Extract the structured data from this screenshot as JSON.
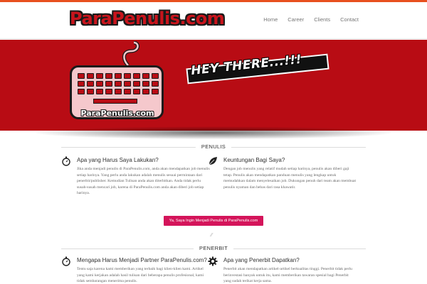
{
  "brand": {
    "logo_text": "ParaPenulis.com",
    "accent_color": "#e8501f",
    "banner_color": "#b80c14",
    "cta_color": "#d4145a"
  },
  "nav": {
    "items": [
      "Home",
      "Career",
      "Clients",
      "Contact"
    ]
  },
  "banner": {
    "keyboard_label": "ParaPenulis.com",
    "greeting": "HEY THERE...!!!"
  },
  "penulis": {
    "section_title": "PENULIS",
    "left": {
      "icon": "stopwatch-icon",
      "title": "Apa yang Harus Saya Lakukan?",
      "body": "Jika anda menjadi penulis di ParaPenulis.com, anda akan mendapatkan job menulis setiap harinya. Yang perlu anda lakukan adalah menulis sesuai permintaan dari penerbit/publisher. Kemudian Tulisan anda akan diterbitkan. Anda tidak perlu susah-susah mencari job, karena di ParaPenulis.com anda akan diberi job setiap harinya."
    },
    "right": {
      "icon": "leaf-icon",
      "title": "Keuntungan Bagi Saya?",
      "body": "Dengan job menulis yang relatif mudah setiap harinya, penulis akan diberi gaji tetap. Penulis akan mendapatkan panduan menulis yang lengkap untuk memudahkan dalam menyelesaikan job. Dukungan penuh dari team akan membuat penulis nyaman dan bebas dari rasa khawatir."
    },
    "cta_label": "Ya, Saya Ingin Menjadi Penulis di ParaPenulis.com"
  },
  "penerbit": {
    "section_title": "PENERBIT",
    "left": {
      "icon": "stopwatch-icon",
      "title": "Mengapa Harus Menjadi Partner ParaPenulis.com?",
      "body": "Tentu saja karena kami memberikan yang terbaik bagi klien-klien kami. Artikel yang kami kerjakan adalah hasil tulisan dari beberapa penulis profesional, kami tidak sembarangan menerima penulis."
    },
    "right": {
      "icon": "gear-icon",
      "title": "Apa yang Penerbit Dapatkan?",
      "body": "Penerbit akan mendapatkan artikel-artikel berkualitas tinggi. Penerbit tidak perlu berinvestasi banyak untuk itu, kami memberikan tawaran spesial bagi Penerbit yang sudah terikat kerja sama."
    }
  }
}
